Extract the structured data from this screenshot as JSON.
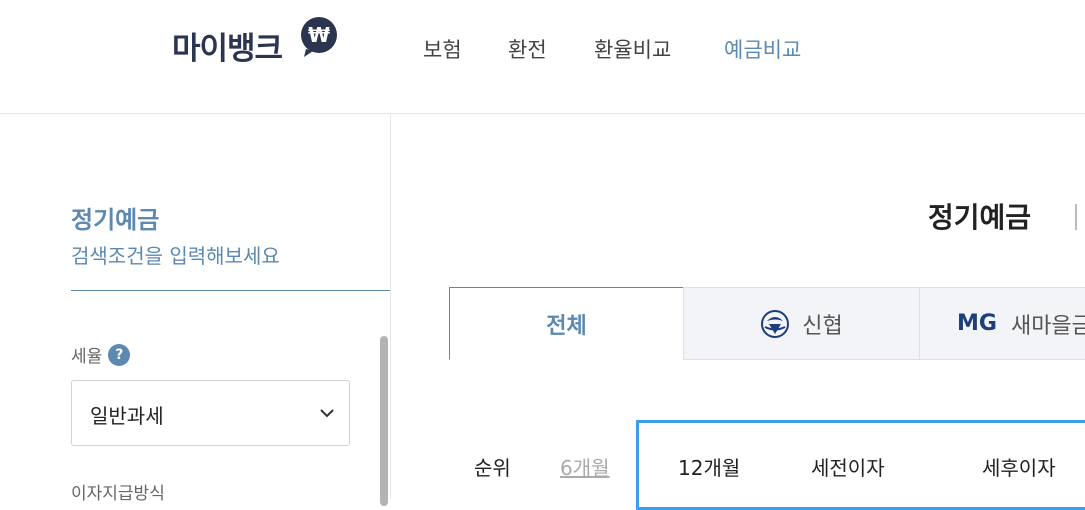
{
  "header": {
    "logo_text": "마이뱅크",
    "logo_badge_symbol": "₩",
    "nav": [
      {
        "label": "보험"
      },
      {
        "label": "환전"
      },
      {
        "label": "환율비교"
      },
      {
        "label": "예금비교",
        "active": true
      }
    ]
  },
  "sidebar": {
    "title": "정기예금",
    "subtitle": "검색조건을 입력해보세요",
    "tax_label": "세율",
    "help_symbol": "?",
    "tax_select_value": "일반과세",
    "payout_label": "이자지급방식"
  },
  "main": {
    "title": "정기예금",
    "tabs": [
      {
        "label": "전체",
        "active": true
      },
      {
        "label": "신협",
        "icon": "shinhyup-logo-icon"
      },
      {
        "label": "새마을금",
        "prefix": "MG"
      }
    ],
    "table_header": {
      "rank": "순위",
      "period_6": "6개월",
      "period_12": "12개월",
      "pre_tax": "세전이자",
      "post_tax": "세후이자"
    }
  },
  "colors": {
    "accent": "#5b89b0",
    "highlight": "#3b9ee7",
    "logo": "#2b3550"
  }
}
